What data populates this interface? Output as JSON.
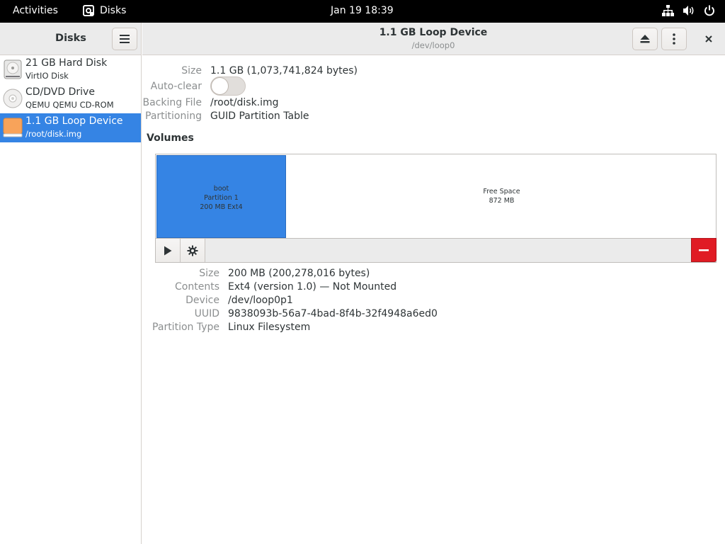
{
  "topbar": {
    "activities": "Activities",
    "app_name": "Disks",
    "clock": "Jan 19  18:39",
    "icons": [
      "network-icon",
      "volume-icon",
      "power-icon"
    ]
  },
  "sidebar": {
    "title": "Disks",
    "items": [
      {
        "name": "21 GB Hard Disk",
        "sub": "VirtIO Disk",
        "icon": "hard-disk-icon",
        "selected": false
      },
      {
        "name": "CD/DVD Drive",
        "sub": "QEMU QEMU CD-ROM",
        "icon": "optical-drive-icon",
        "selected": false
      },
      {
        "name": "1.1 GB Loop Device",
        "sub": "/root/disk.img",
        "icon": "loop-device-icon",
        "selected": true
      }
    ]
  },
  "header": {
    "title": "1.1 GB Loop Device",
    "subtitle": "/dev/loop0",
    "buttons": [
      "eject-icon",
      "more-options-icon",
      "close-icon"
    ]
  },
  "drive": {
    "size_label": "Size",
    "size_value": "1.1 GB (1,073,741,824 bytes)",
    "autoclear_label": "Auto-clear",
    "autoclear_on": false,
    "backing_label": "Backing File",
    "backing_value": "/root/disk.img",
    "partitioning_label": "Partitioning",
    "partitioning_value": "GUID Partition Table"
  },
  "volumes": {
    "title": "Volumes",
    "partitions": [
      {
        "line1": "boot",
        "line2": "Partition 1",
        "line3": "200 MB Ext4",
        "selected": true,
        "color": "#3584e4"
      },
      {
        "line1": "Free Space",
        "line2": "872 MB",
        "selected": false
      }
    ],
    "toolbar": [
      "play-icon",
      "gear-icon",
      "minus-icon"
    ],
    "delete_color": "#e01b24"
  },
  "partition": {
    "size_label": "Size",
    "size_value": "200 MB (200,278,016 bytes)",
    "contents_label": "Contents",
    "contents_value": "Ext4 (version 1.0) — Not Mounted",
    "device_label": "Device",
    "device_value": "/dev/loop0p1",
    "uuid_label": "UUID",
    "uuid_value": "9838093b-56a7-4bad-8f4b-32f4948a6ed0",
    "type_label": "Partition Type",
    "type_value": "Linux Filesystem"
  },
  "colors": {
    "accent": "#3584e4",
    "danger": "#e01b24",
    "dim_text": "#8b8e8f"
  }
}
